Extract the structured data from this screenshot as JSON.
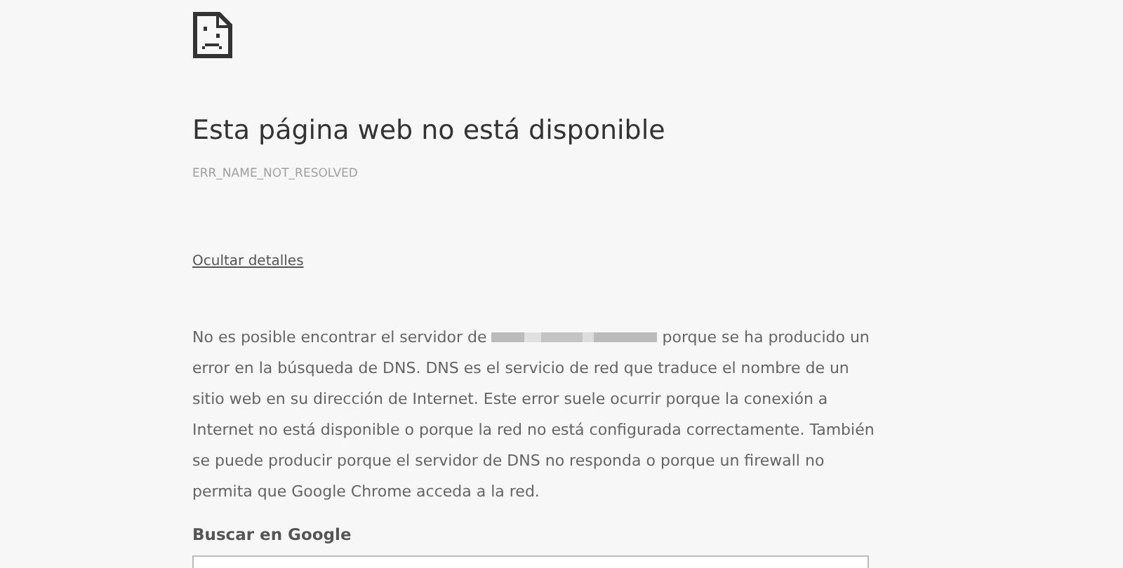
{
  "title": "Esta página web no está disponible",
  "error_code": "ERR_NAME_NOT_RESOLVED",
  "details_link": "Ocultar detalles",
  "details": {
    "text_before": "No es posible encontrar el servidor de",
    "text_after": "porque se ha producido un error en la búsqueda de DNS. DNS es el servicio de red que traduce el nombre de un sitio web en su dirección de Internet. Este error suele ocurrir porque la conexión a Internet no está disponible o porque la red no está configurada correctamente. También se puede producir porque el servidor de DNS no responda o porque un firewall no permita que Google Chrome acceda a la red."
  },
  "search": {
    "heading": "Buscar en Google"
  }
}
